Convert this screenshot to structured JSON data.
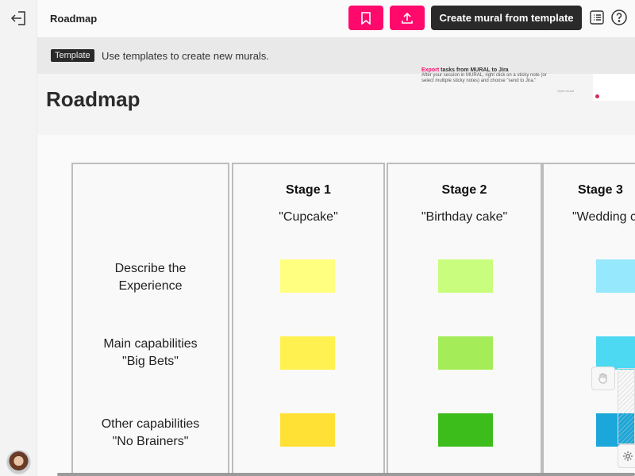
{
  "topbar": {
    "title": "Roadmap",
    "create_button": "Create mural from template",
    "icons": {
      "exit": "exit-icon",
      "bookmark": "bookmark-icon",
      "share": "upload-icon",
      "outline": "list-icon",
      "help": "help-icon"
    },
    "accent_color": "#ff0a6c"
  },
  "banner": {
    "tag": "Template",
    "text": "Use templates to create new murals."
  },
  "header": {
    "title": "Roadmap",
    "preview": {
      "title_highlight": "Export",
      "title_rest": " tasks from MURAL to Jira",
      "body": "After your session in MURAL, right click on a sticky note (or select multiple sticky notes) and choose \"send to Jira.\"",
      "open_label": "Open mural"
    }
  },
  "board": {
    "row_labels": [
      {
        "line1": "Describe the",
        "line2": "Experience"
      },
      {
        "line1": "Main capabilities",
        "line2": "\"Big Bets\""
      },
      {
        "line1": "Other capabilities",
        "line2": "\"No Brainers\""
      }
    ],
    "stages": [
      {
        "title": "Stage 1",
        "subtitle": "\"Cupcake\"",
        "sticky_colors": [
          "#ffff80",
          "#fff250",
          "#ffe034"
        ]
      },
      {
        "title": "Stage 2",
        "subtitle": "\"Birthday cake\"",
        "sticky_colors": [
          "#c9fd7d",
          "#a4ec58",
          "#3cbd1c"
        ]
      },
      {
        "title": "Stage 3",
        "subtitle": "\"Wedding cake\"",
        "sticky_colors": [
          "#96e8fc",
          "#4dd9f2",
          "#1ba7da"
        ]
      }
    ]
  }
}
